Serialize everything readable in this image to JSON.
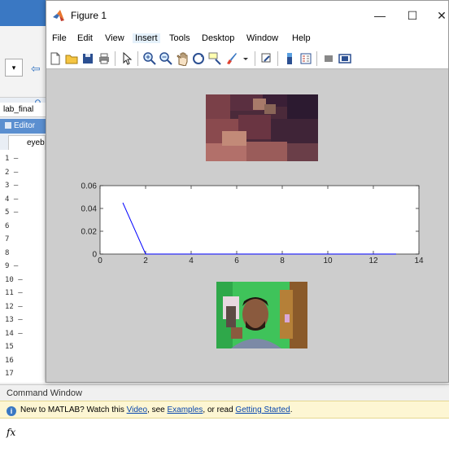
{
  "desktop": {
    "dropdown_glyph": "▾",
    "file_label": "lab_final",
    "editor_label": "Editor",
    "editor_tab_label": "eyeb",
    "line_numbers": [
      "1 –",
      "2 –",
      "3 –",
      "4 –",
      "5 –",
      "6",
      "7",
      "8",
      "9 –",
      "10 –",
      "11 –",
      "12 –",
      "13 –",
      "14 –",
      "15",
      "16",
      "17"
    ]
  },
  "figure": {
    "title": "Figure 1",
    "window_buttons": {
      "minimize": "—",
      "maximize": "☐",
      "close": "✕"
    },
    "menu": [
      "File",
      "Edit",
      "View",
      "Insert",
      "Tools",
      "Desktop",
      "Window",
      "Help"
    ],
    "active_menu_index": 3,
    "toolbar_icons": [
      "new-figure-icon",
      "open-file-icon",
      "save-icon",
      "print-icon",
      "select-arrow-icon",
      "zoom-in-icon",
      "zoom-out-icon",
      "pan-hand-icon",
      "rotate-3d-icon",
      "data-cursor-icon",
      "brush-icon",
      "link-plot-icon",
      "colorbar-icon",
      "legend-icon",
      "hide-plot-tools-icon",
      "show-plot-tools-icon"
    ]
  },
  "chart_data": {
    "type": "line",
    "x": [
      1,
      2,
      3,
      4,
      5,
      6,
      7,
      8,
      9,
      10,
      11,
      12,
      13
    ],
    "series": [
      {
        "values": [
          0.045,
          0.0,
          0.0,
          0.0,
          0.0,
          0.0,
          0.0,
          0.0,
          0.0,
          0.0,
          0.0,
          0.0,
          0.0
        ],
        "color": "#0000ff"
      }
    ],
    "xlim": [
      0,
      14
    ],
    "ylim": [
      0,
      0.06
    ],
    "xticks": [
      0,
      2,
      4,
      6,
      8,
      10,
      12,
      14
    ],
    "yticks": [
      "0",
      "0.02",
      "0.04",
      "0.06"
    ],
    "title": "",
    "xlabel": "",
    "ylabel": "",
    "grid": false
  },
  "command_window": {
    "title": "Command Window",
    "banner_prefix": "New to MATLAB? Watch this ",
    "banner_link1": "Video",
    "banner_mid1": ", see ",
    "banner_link2": "Examples",
    "banner_mid2": ", or read ",
    "banner_link3": "Getting Started",
    "banner_suffix": ".",
    "prompt": "fx"
  }
}
